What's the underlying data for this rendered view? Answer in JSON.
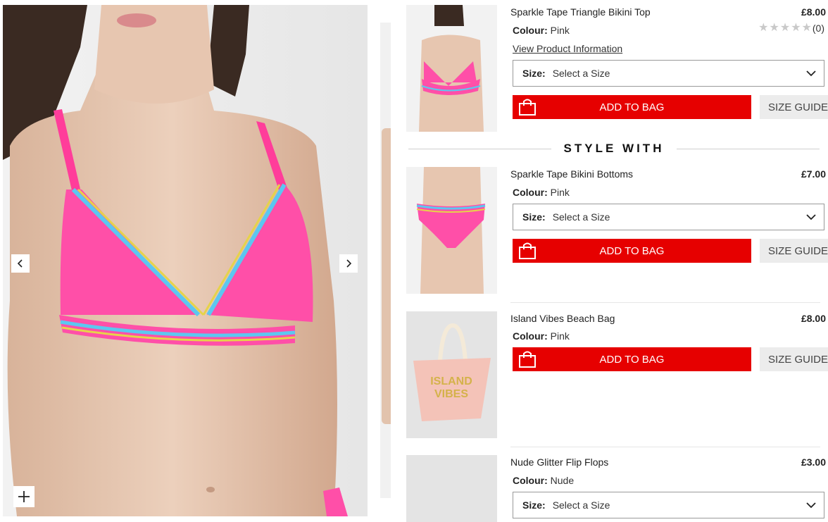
{
  "gallery": {
    "prev_label": "Previous image",
    "next_label": "Next image",
    "zoom_label": "Zoom"
  },
  "products": [
    {
      "name": "Sparkle Tape Triangle Bikini Top",
      "price": "£8.00",
      "colour_label": "Colour:",
      "colour_value": "Pink",
      "rating_count": "(0)",
      "rating_stars": 0,
      "view_info": "View Product Information",
      "size_label": "Size:",
      "size_placeholder": "Select a Size",
      "add_to_bag": "ADD TO BAG",
      "size_guide": "SIZE GUIDE"
    },
    {
      "name": "Sparkle Tape Bikini Bottoms",
      "price": "£7.00",
      "colour_label": "Colour:",
      "colour_value": "Pink",
      "size_label": "Size:",
      "size_placeholder": "Select a Size",
      "add_to_bag": "ADD TO BAG",
      "size_guide": "SIZE GUIDE"
    },
    {
      "name": "Island Vibes Beach Bag",
      "price": "£8.00",
      "colour_label": "Colour:",
      "colour_value": "Pink",
      "add_to_bag": "ADD TO BAG",
      "size_guide": "SIZE GUIDE",
      "image_text_1": "ISLAND",
      "image_text_2": "VIBES"
    },
    {
      "name": "Nude Glitter Flip Flops",
      "price": "£3.00",
      "colour_label": "Colour:",
      "colour_value": "Nude",
      "size_label": "Size:",
      "size_placeholder": "Select a Size"
    }
  ],
  "style_with": "STYLE WITH",
  "colors": {
    "add_to_bag_bg": "#e60000",
    "size_guide_bg": "#ececec",
    "bikini_pink": "#ff4fa8"
  },
  "icons": [
    "chevron-left-icon",
    "chevron-right-icon",
    "plus-icon",
    "shopping-bag-icon",
    "chevron-down-icon",
    "star-icon"
  ]
}
